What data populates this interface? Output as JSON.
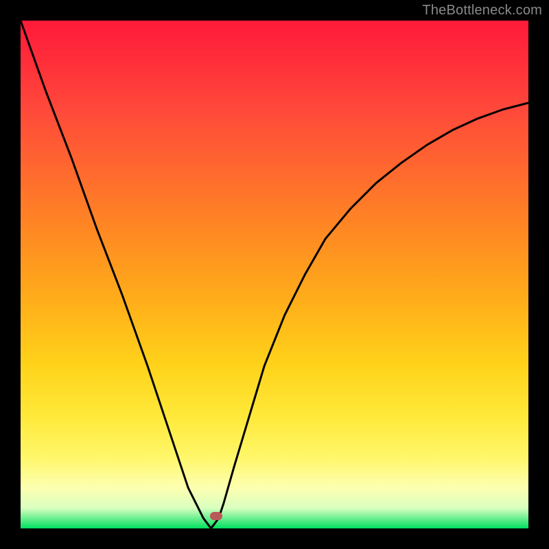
{
  "watermark": "TheBottleneck.com",
  "colors": {
    "curve_stroke": "#000000",
    "marker_fill": "#b85a5a",
    "frame_bg": "#000000"
  },
  "chart_data": {
    "type": "line",
    "title": "",
    "xlabel": "",
    "ylabel": "",
    "xlim": [
      0,
      100
    ],
    "ylim": [
      0,
      100
    ],
    "grid": false,
    "legend": false,
    "series": [
      {
        "name": "bottleneck-curve",
        "x": [
          0,
          5,
          10,
          15,
          20,
          25,
          30,
          33,
          36,
          37.5,
          39,
          40,
          42,
          45,
          48,
          52,
          56,
          60,
          65,
          70,
          75,
          80,
          85,
          90,
          95,
          100
        ],
        "values": [
          100,
          86,
          73,
          59,
          46,
          32,
          17,
          8,
          2,
          0,
          2,
          5,
          12,
          22,
          32,
          42,
          50,
          57,
          63,
          68,
          72,
          75.5,
          78.4,
          80.7,
          82.5,
          83.8
        ]
      }
    ],
    "marker": {
      "x": 38.5,
      "y": 2.5
    },
    "gradient_stops": [
      {
        "pos": 0,
        "color": "#ff1a3a"
      },
      {
        "pos": 55,
        "color": "#ffd31a"
      },
      {
        "pos": 92,
        "color": "#fdffb0"
      },
      {
        "pos": 100,
        "color": "#00e060"
      }
    ]
  }
}
